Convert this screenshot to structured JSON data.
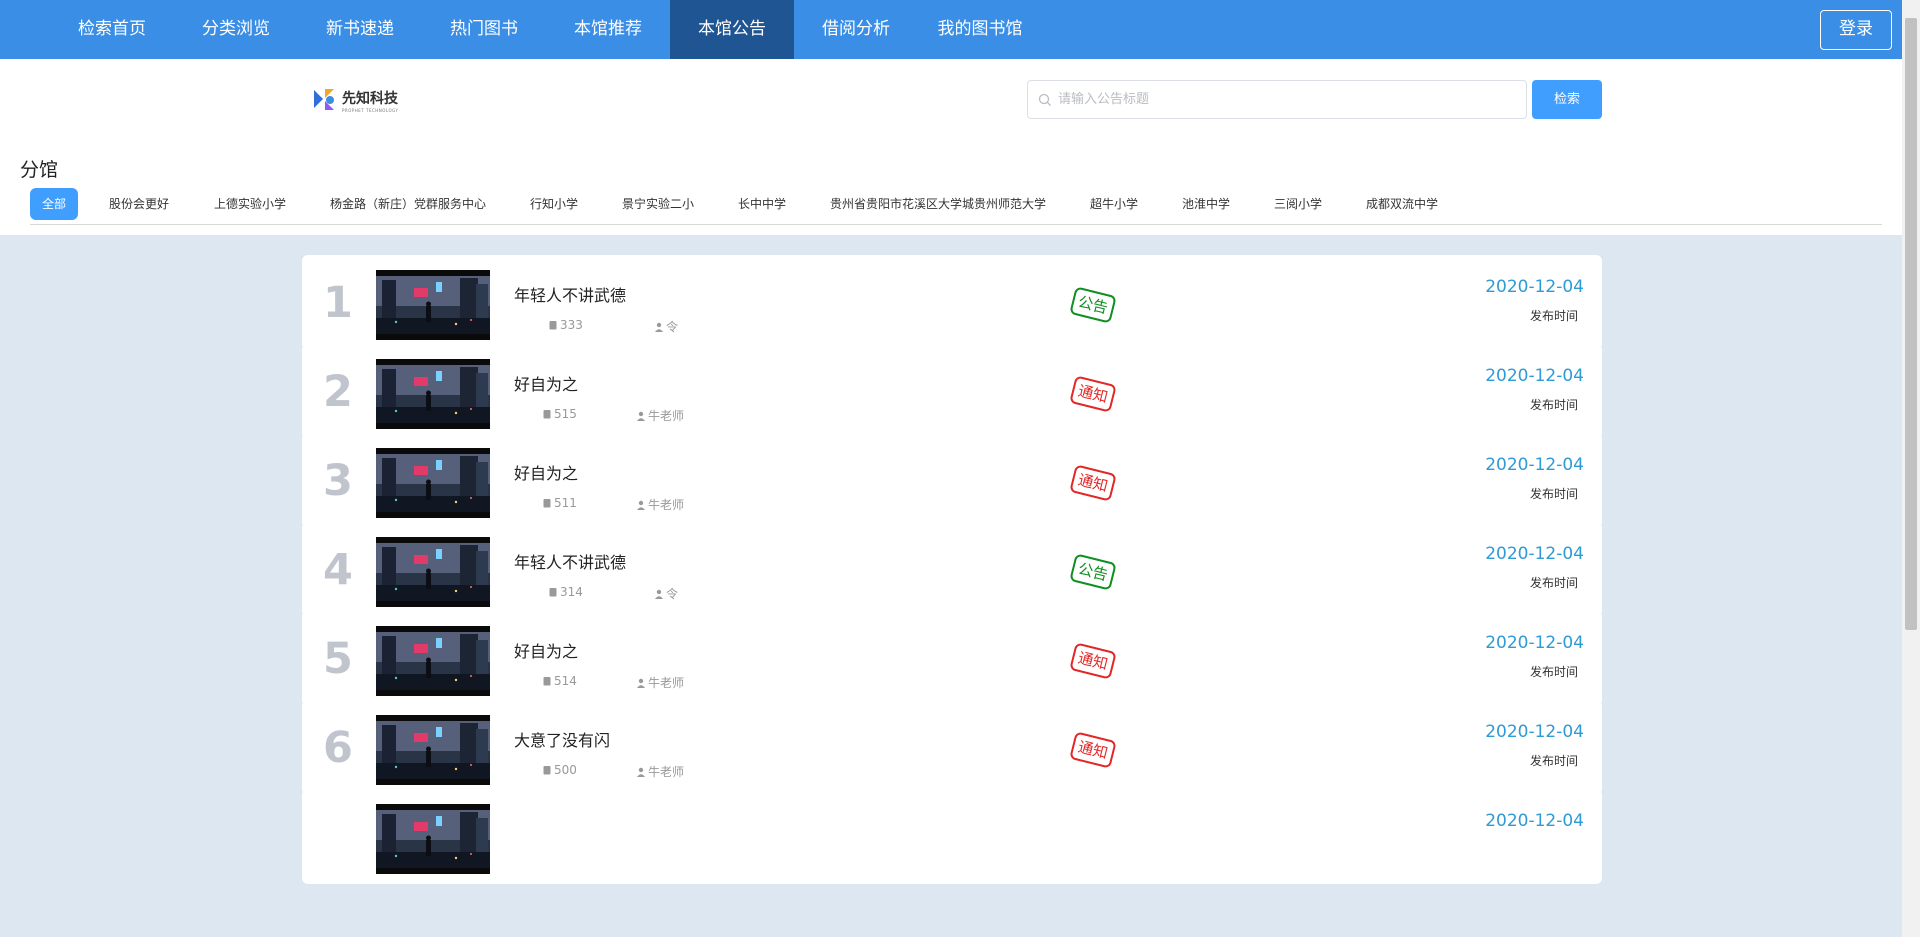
{
  "nav": {
    "items": [
      {
        "label": "检索首页"
      },
      {
        "label": "分类浏览"
      },
      {
        "label": "新书速递"
      },
      {
        "label": "热门图书"
      },
      {
        "label": "本馆推荐"
      },
      {
        "label": "本馆公告",
        "active": true
      },
      {
        "label": "借阅分析"
      },
      {
        "label": "我的图书馆"
      }
    ],
    "login_label": "登录",
    "bg_color": "#3a8ee6",
    "active_color": "#1f5593"
  },
  "logo": {
    "name": "先知科技",
    "sub": "PROPHET TECHNOLOGY"
  },
  "search": {
    "placeholder": "请输入公告标题",
    "value": "",
    "button_label": "检索"
  },
  "branches": {
    "title": "分馆",
    "tabs": [
      "全部",
      "股份会更好",
      "上德实验小学",
      "杨金路（新庄）党群服务中心",
      "行知小学",
      "景宁实验二小",
      "长中中学",
      "贵州省贵阳市花溪区大学城贵州师范大学",
      "超牛小学",
      "池淮中学",
      "三阅小学",
      "成都双流中学"
    ],
    "active_index": 0
  },
  "announcements": [
    {
      "rank": "1",
      "title": "年轻人不讲武德",
      "views": "333",
      "author": "令",
      "stamp": "公告",
      "stamp_type": "green",
      "date": "2020-12-04",
      "date_label": "发布时间"
    },
    {
      "rank": "2",
      "title": "好自为之",
      "views": "515",
      "author": "牛老师",
      "stamp": "通知",
      "stamp_type": "red",
      "date": "2020-12-04",
      "date_label": "发布时间"
    },
    {
      "rank": "3",
      "title": "好自为之",
      "views": "511",
      "author": "牛老师",
      "stamp": "通知",
      "stamp_type": "red",
      "date": "2020-12-04",
      "date_label": "发布时间"
    },
    {
      "rank": "4",
      "title": "年轻人不讲武德",
      "views": "314",
      "author": "令",
      "stamp": "公告",
      "stamp_type": "green",
      "date": "2020-12-04",
      "date_label": "发布时间"
    },
    {
      "rank": "5",
      "title": "好自为之",
      "views": "514",
      "author": "牛老师",
      "stamp": "通知",
      "stamp_type": "red",
      "date": "2020-12-04",
      "date_label": "发布时间"
    },
    {
      "rank": "6",
      "title": "大意了没有闪",
      "views": "500",
      "author": "牛老师",
      "stamp": "通知",
      "stamp_type": "red",
      "date": "2020-12-04",
      "date_label": "发布时间"
    },
    {
      "rank": "",
      "title": "",
      "views": "",
      "author": "",
      "stamp": "",
      "stamp_type": "",
      "date": "2020-12-04",
      "date_label": ""
    }
  ]
}
